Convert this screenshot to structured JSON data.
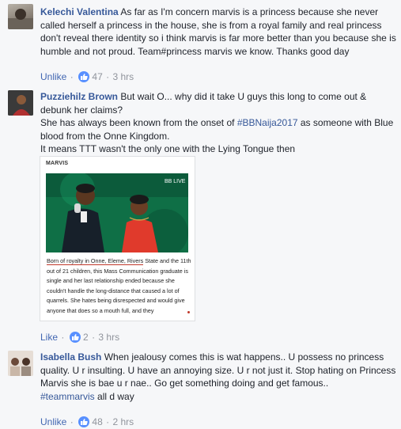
{
  "comments": [
    {
      "author": "Kelechi Valentina",
      "text": "As far as I'm concern marvis is a princess because she never called herself a princess in the house, she is from a royal family and real princess don't reveal there identity so i think marvis is far more better than you because she is humble and not proud. Team#princess marvis we know. Thanks good day",
      "unlike_label": "Unlike",
      "reactions": "47",
      "time": "3 hrs"
    },
    {
      "author": "Puzziehilz Brown",
      "text_line1": "But wait O... why did it take U guys this long to come out & debunk her claims?",
      "text_line2_pre": "She has always been known from the onset of ",
      "hashtag": "#BBNaija2017",
      "text_line2_post": " as someone with Blue blood from the Onne Kingdom.",
      "text_line3": "It means TTT wasn't the only one with the Lying Tongue then",
      "card": {
        "label": "MARVIS",
        "photo_badge": "BB LIVE",
        "caption_underlined": "Born of royalty in Onne, Eleme, Rivers",
        "caption_rest": " State and the 11th out of 21 children, this Mass Communication graduate is single and her last relationship ended because she couldn't handle the long-distance that caused a lot of quarrels. She hates being disrespected and would give anyone that does so a mouth full, and they"
      },
      "like_label": "Like",
      "reactions": "2",
      "time": "3 hrs"
    },
    {
      "author": "Isabella Bush",
      "text": "When jealousy comes this is wat happens.. U possess no princess quality. U r insulting. U have an annoying size. U r not just it. Stop hating on Princess Marvis she is bae u r nae.. Go get something doing and get famous..",
      "hashtag": "#teammarvis",
      "hashtag_tail": " all d way",
      "unlike_label": "Unlike",
      "reactions": "48",
      "time": "2 hrs"
    }
  ],
  "colors": {
    "name": "#365899",
    "action_link": "#4267b2",
    "meta": "#90949c",
    "like_bubble": "#5890ff",
    "background": "#f6f7f9"
  },
  "icons": {
    "reaction": "thumbs-up-icon"
  }
}
